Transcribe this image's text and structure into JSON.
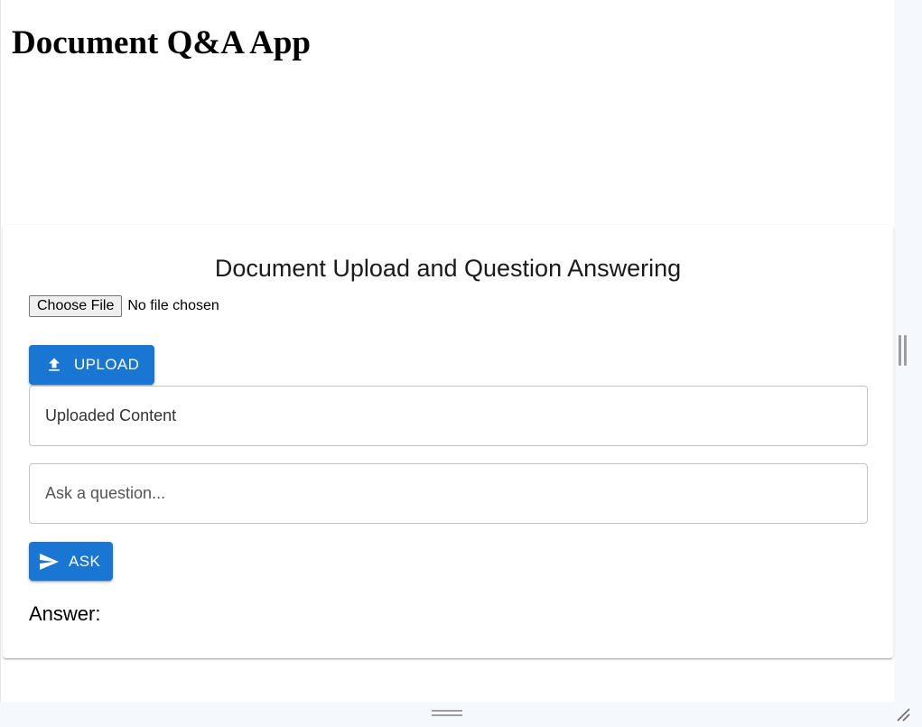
{
  "app": {
    "title": "Document Q&A App"
  },
  "card": {
    "title": "Document Upload and Question Answering",
    "file_input": {
      "button_label": "Choose File",
      "status": "No file chosen"
    },
    "upload_button": {
      "label": "UPLOAD",
      "icon": "upload-icon"
    },
    "uploaded_content": {
      "placeholder": "Uploaded Content"
    },
    "question_input": {
      "placeholder": "Ask a question..."
    },
    "ask_button": {
      "label": "ASK",
      "icon": "send-icon"
    },
    "answer_label": "Answer:"
  },
  "colors": {
    "primary": "#1976d2",
    "border": "#c4c4c4"
  }
}
